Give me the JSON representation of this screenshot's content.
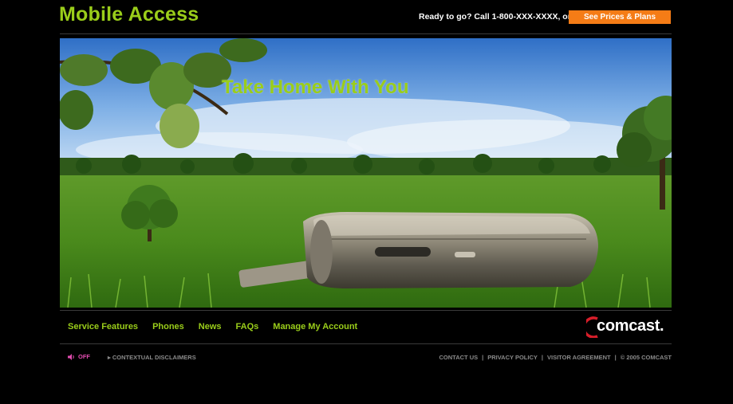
{
  "header": {
    "title": "Mobile Access",
    "ready_text": "Ready to go? Call 1-800-XXX-XXXX, or",
    "cta_label": "See Prices & Plans"
  },
  "hero": {
    "headline": "Take Home With You"
  },
  "nav": {
    "items": [
      "Service Features",
      "Phones",
      "News",
      "FAQs",
      "Manage My Account"
    ]
  },
  "logo": {
    "text": "comcast."
  },
  "footer": {
    "sound_label": "OFF",
    "disclaimers": "CONTEXTUAL DISCLAIMERS",
    "links": [
      "CONTACT US",
      "PRIVACY POLICY",
      "VISITOR AGREEMENT",
      "© 2005 COMCAST"
    ]
  },
  "colors": {
    "accent": "#9ACD1A",
    "cta": "#F57C16",
    "background": "#000000"
  }
}
